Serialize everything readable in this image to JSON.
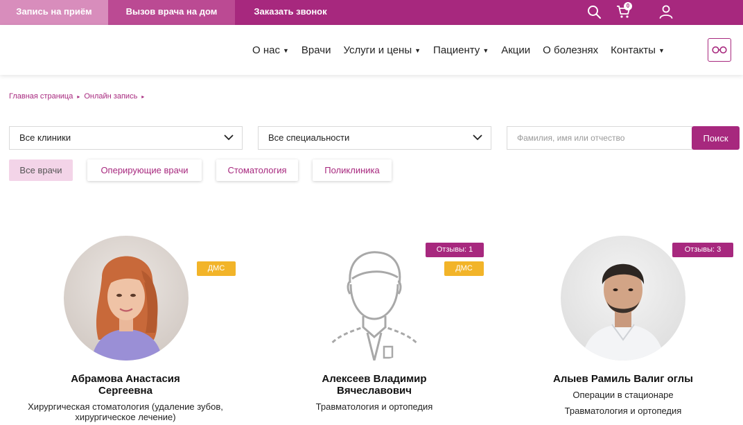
{
  "topbar": {
    "appointment": "Запись на приём",
    "home_visit": "Вызов врача на дом",
    "callback": "Заказать звонок",
    "cart_count": "0"
  },
  "nav": {
    "about": "О нас",
    "doctors": "Врачи",
    "services": "Услуги и цены",
    "patient": "Пациенту",
    "promos": "Акции",
    "diseases": "О болезнях",
    "contacts": "Контакты"
  },
  "breadcrumb": {
    "home": "Главная страница",
    "online": "Онлайн запись",
    "separator": "▸"
  },
  "filters": {
    "clinics": "Все клиники",
    "specialties": "Все специальности",
    "search_placeholder": "Фамилия, имя или отчество",
    "search_button": "Поиск"
  },
  "tabs": {
    "all": "Все врачи",
    "surgeons": "Оперирующие врачи",
    "dentistry": "Стоматология",
    "polyclinic": "Поликлиника"
  },
  "doctors": [
    {
      "name_line1": "Абрамова Анастасия",
      "name_line2": "Сергеевна",
      "spec_line1": "Хирургическая стоматология (удаление зубов,",
      "spec_line2": "хирургическое лечение)",
      "dms": "ДМС"
    },
    {
      "name_line1": "Алексеев Владимир",
      "name_line2": "Вячеславович",
      "spec_line1": "Травматология и ортопедия",
      "reviews": "Отзывы: 1",
      "dms": "ДМС"
    },
    {
      "name_line1": "Алыев Рамиль Валиг оглы",
      "spec_line1": "Операции в стационаре",
      "spec_line2": "Травматология и ортопедия",
      "reviews": "Отзывы: 3"
    }
  ],
  "colors": {
    "brand": "#a7287e",
    "brand_light": "#d88dbc",
    "dms": "#f2b429"
  }
}
